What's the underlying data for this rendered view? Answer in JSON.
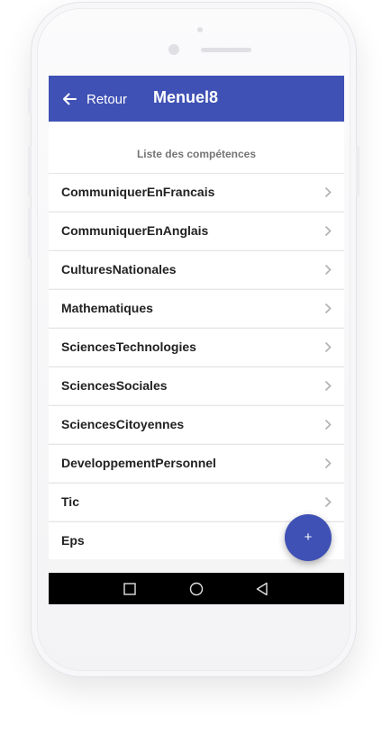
{
  "app_bar": {
    "back_label": "Retour",
    "title": "Menuel8",
    "color": "#3f51b5"
  },
  "section": {
    "header": "Liste des compétences"
  },
  "competences": [
    {
      "label": "CommuniquerEnFrancais"
    },
    {
      "label": "CommuniquerEnAnglais"
    },
    {
      "label": "CulturesNationales"
    },
    {
      "label": "Mathematiques"
    },
    {
      "label": "SciencesTechnologies"
    },
    {
      "label": "SciencesSociales"
    },
    {
      "label": "SciencesCitoyennes"
    },
    {
      "label": "DeveloppementPersonnel"
    },
    {
      "label": "Tic"
    },
    {
      "label": "Eps"
    }
  ],
  "fab": {
    "label": "+",
    "icon": "plus-icon"
  },
  "system_nav": {
    "icons": [
      "recent-apps-icon",
      "home-icon",
      "back-triangle-icon"
    ]
  }
}
